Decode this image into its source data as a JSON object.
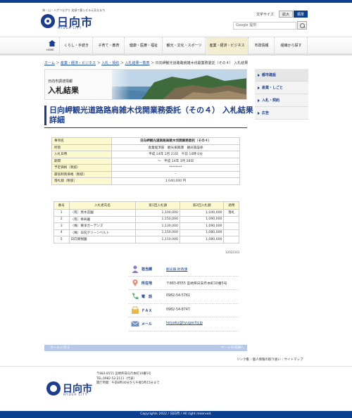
{
  "header": {
    "tagline": "海・山・人がつながり 笑顔で暮らせる元気なまち",
    "logo": "日向市",
    "logo_sub": "HYUGA CITY",
    "fontsize_label": "文字サイズ",
    "fontsize_large": "拡大",
    "fontsize_standard": "標準",
    "search_placeholder": "Google 提供"
  },
  "gnav": {
    "home": "HOME",
    "items": [
      "くらし・手続き",
      "子育て・教育",
      "健康・医療・福祉",
      "観光・文化・スポーツ",
      "産業・経済・ビジネス",
      "市政情報",
      "組織から探す"
    ],
    "active_index": 4
  },
  "breadcrumb": {
    "items": [
      "ホーム",
      "産業・経済・ビジネス",
      "入札・契約",
      "入札結果一覧表"
    ],
    "current": "日向岬観光道路路肩雑木伐開業務委託（その４） 入札結果"
  },
  "hero": {
    "sub": "日向市調達情報",
    "title": "入札結果"
  },
  "sidenav": [
    "都市建設",
    "産業・しごと",
    "入札・契約",
    "広告"
  ],
  "page_title": "日向岬観光道路路肩雑木伐開業務委託（その４） 入札結果詳細",
  "detail": [
    {
      "k": "事項名",
      "v": "日向岬観光道路路肩雑木伐開業務委託（その４）"
    },
    {
      "k": "所管",
      "v": "産業経済部　観光振興課　観光施設係"
    },
    {
      "k": "入札日時",
      "v": "平成 24年 2月 21日　午前 10時 0分"
    },
    {
      "k": "期間",
      "v": "～　平成 24年 3月 28日"
    },
    {
      "k": "予定価格（税抜）",
      "v": "********"
    },
    {
      "k": "最低制限価格（税抜）",
      "v": "--"
    },
    {
      "k": "落札額（税抜）",
      "v": "1,040,000 円"
    }
  ],
  "bids": {
    "headers": [
      "番号",
      "入札者氏名",
      "第1回入札額",
      "第2回入札額",
      "適用"
    ],
    "rows": [
      {
        "no": "1",
        "name": "（有）黒木造園",
        "r1": "1,100,000",
        "r2": "1,040,000",
        "note": "落札"
      },
      {
        "no": "2",
        "name": "（有）章寿園",
        "r1": "1,150,000",
        "r2": "1,090,000",
        "note": ""
      },
      {
        "no": "3",
        "name": "（株）東洋ガーデンズ",
        "r1": "1,130,000",
        "r2": "1,090,000",
        "note": ""
      },
      {
        "no": "4",
        "name": "（株）日向グリーンベルト",
        "r1": "1,150,000",
        "r2": "1,080,000",
        "note": ""
      },
      {
        "no": "5",
        "name": "日向果樹園",
        "r1": "1,110,000",
        "r2": "1,080,000",
        "note": ""
      }
    ],
    "code": "12022101"
  },
  "contact": [
    {
      "label": "担当課",
      "value": "観光振 財政課",
      "link": true,
      "icon": "person-icon"
    },
    {
      "label": "所在地",
      "value": "〒883-8555 宮崎県日向市本町10番5号",
      "link": false,
      "icon": "location-pin-icon"
    },
    {
      "label": "電　話",
      "value": "0982-54-5761",
      "link": false,
      "icon": "phone-icon"
    },
    {
      "label": "ＦＡＸ",
      "value": "0982-54-8747",
      "link": false,
      "icon": "fax-icon"
    },
    {
      "label": "メール",
      "value": "keiyaku@hyugacity.jp",
      "link": true,
      "icon": "mail-icon"
    }
  ],
  "pagebar": {
    "left": "ホームに戻る",
    "right": "ページの先頭へ"
  },
  "footlinks": "リンク集｜個人情報の取り扱い｜サイトマップ",
  "footer": {
    "logo": "日向市",
    "logo_sub": "HYUGA CITY",
    "addr1": "〒883-8555 宮崎県日向市本町10番5号",
    "addr2": "TEL.0982-52-2111（代表）",
    "addr3": "開庁時間：午前8時30分から午後5時15分まで"
  },
  "copyright": "Copyrights 2022 / 日向市 / All right reserved."
}
